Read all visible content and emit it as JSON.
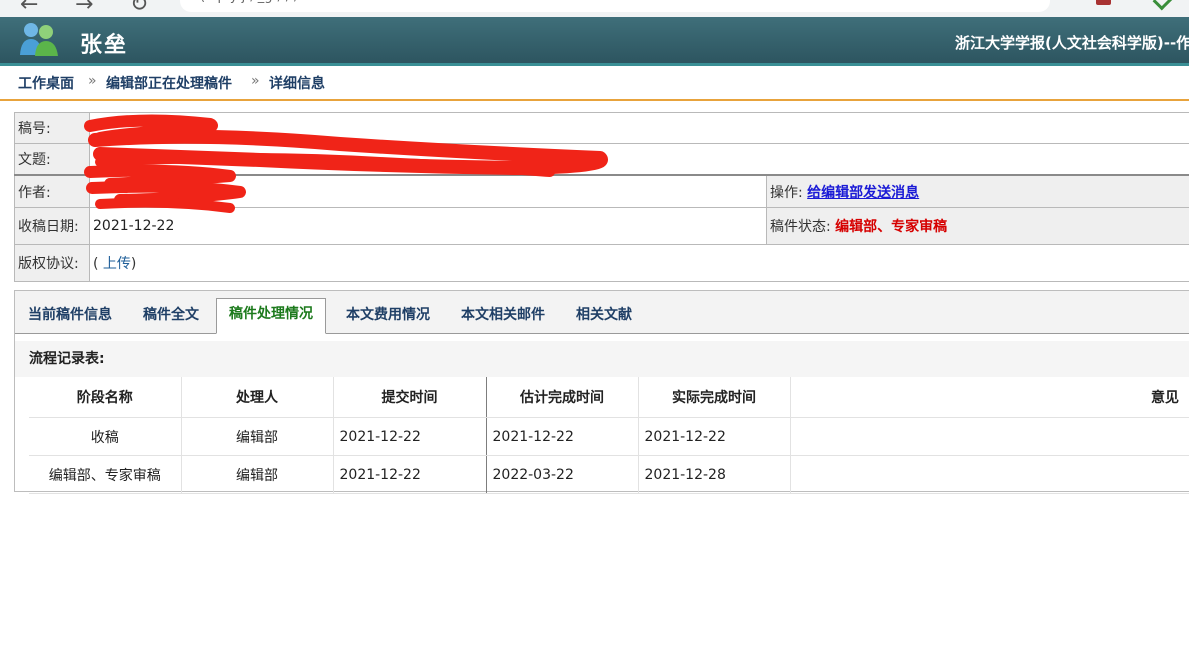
{
  "chrome": {
    "url_text": "( .   p      y j        ,        _g   ,  ,    ,"
  },
  "header": {
    "username": "张垒",
    "journal_title": "浙江大学学报(人文社会科学版)--作者"
  },
  "breadcrumb": {
    "items": [
      "工作桌面",
      "编辑部正在处理稿件",
      "详细信息"
    ],
    "separator": "»"
  },
  "info": {
    "manuscript_no_label": "稿号:",
    "title_label": "文题:",
    "author_label": "作者:",
    "operation_label": "操作:",
    "operation_link": "给编辑部发送消息",
    "received_date_label": "收稿日期:",
    "received_date": "2021-12-22",
    "status_label": "稿件状态:",
    "status_value": "编辑部、专家审稿",
    "copyright_label": "版权协议:",
    "copyright_open": "(",
    "copyright_upload": "上传",
    "copyright_close": ")"
  },
  "tabs": [
    {
      "label": "当前稿件信息",
      "active": false
    },
    {
      "label": "稿件全文",
      "active": false
    },
    {
      "label": "稿件处理情况",
      "active": true
    },
    {
      "label": "本文费用情况",
      "active": false
    },
    {
      "label": "本文相关邮件",
      "active": false
    },
    {
      "label": "相关文献",
      "active": false
    }
  ],
  "flow": {
    "title": "流程记录表:",
    "columns": [
      "阶段名称",
      "处理人",
      "提交时间",
      "估计完成时间",
      "实际完成时间",
      "意见"
    ],
    "rows": [
      [
        "收稿",
        "编辑部",
        "2021-12-22",
        "2021-12-22",
        "2021-12-22",
        ""
      ],
      [
        "编辑部、专家审稿",
        "编辑部",
        "2021-12-22",
        "2022-03-22",
        "2021-12-28",
        ""
      ]
    ]
  },
  "colors": {
    "header_bg": "#2d5560",
    "breadcrumb_rule": "#e8a33c",
    "active_tab_text": "#1c7a1c",
    "status_text": "#d60000",
    "link": "#1a1ad6"
  },
  "icons": [
    "users-icon",
    "back-arrow-icon",
    "forward-arrow-icon",
    "reload-icon"
  ]
}
